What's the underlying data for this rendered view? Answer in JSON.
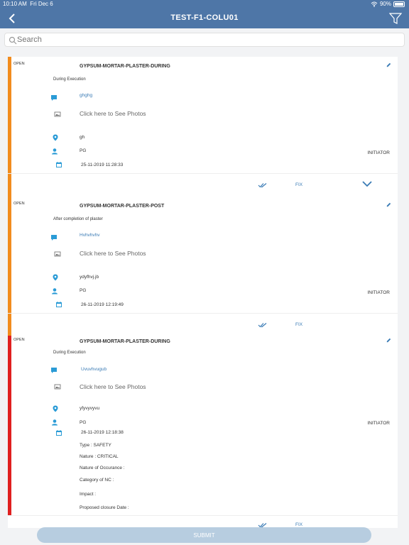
{
  "status_bar": {
    "time": "10:10 AM",
    "date": "Fri Dec 6",
    "battery": "90%"
  },
  "header": {
    "title": "TEST-F1-COLU01",
    "back_icon": "chevron-left-icon",
    "filter_icon": "filter-icon"
  },
  "search": {
    "placeholder": "Search",
    "value": ""
  },
  "colors": {
    "header": "#4e76a7",
    "open_major": "#f28c1e",
    "open_critical": "#e02020",
    "accent": "#3a7bb5"
  },
  "common": {
    "photos_label": "Click here to See Photos",
    "fix_label": "FIX"
  },
  "cards": [
    {
      "status": "OPEN",
      "title": "GYPSUM-MORTAR-PLASTER-DURING",
      "stage": "During Execution",
      "comment": "ghghg",
      "location": "gh",
      "user": "PG",
      "role": "INITIATOR",
      "date": "25-11-2019 11:28:33"
    },
    {
      "status": "OPEN",
      "title": "GYPSUM-MORTAR-PLASTER-POST",
      "stage": "After completion of plaster",
      "comment": "Hvhvhvhv",
      "location": "ydyfhvj.jb",
      "user": "PG",
      "role": "INITIATOR",
      "date": "26-11-2019 12:19:49"
    },
    {
      "status": "OPEN",
      "title": "GYPSUM-MORTAR-PLASTER-DURING",
      "stage": "During Execution",
      "comment": "Uvuvhvugub",
      "location": "yfyvyvyvu",
      "user": "PG",
      "role": "INITIATOR",
      "date": "26-11-2019 12:18:38",
      "details": {
        "type": "Type : SAFETY",
        "nature": "Nature : CRITICAL",
        "occurance": "Nature of Occurance :",
        "category": "Category of NC :",
        "impact": "Impact :",
        "closure": "Proposed closure Date :"
      }
    }
  ],
  "submit": {
    "label": "SUBMIT"
  }
}
